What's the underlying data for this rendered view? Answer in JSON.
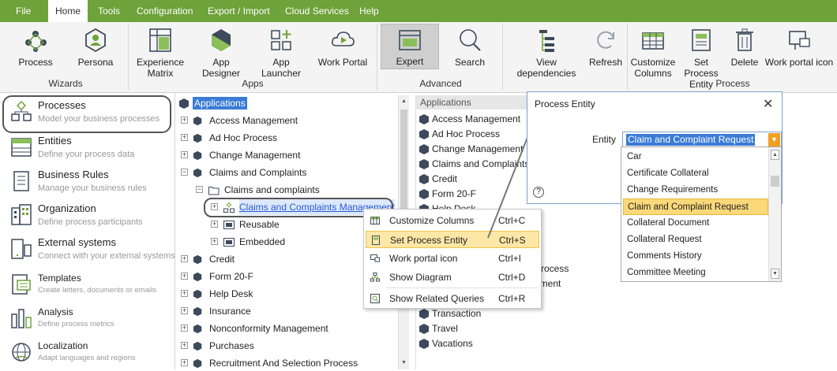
{
  "menubar": {
    "items": [
      "File",
      "Home",
      "Tools",
      "Configuration",
      "Export / Import",
      "Cloud Services",
      "Help"
    ],
    "active": "Home"
  },
  "ribbon": {
    "buttons": [
      {
        "label": "Process"
      },
      {
        "label": "Persona"
      },
      {
        "label": "Experience Matrix"
      },
      {
        "label": "App Designer"
      },
      {
        "label": "App Launcher"
      },
      {
        "label": "Work Portal"
      },
      {
        "label": "Expert"
      },
      {
        "label": "Search"
      },
      {
        "label": "View dependencies"
      },
      {
        "label": "Refresh"
      },
      {
        "label": "Customize Columns"
      },
      {
        "label": "Set Process Entity"
      },
      {
        "label": "Delete"
      },
      {
        "label": "Work portal icon"
      }
    ],
    "groups": [
      "Wizards",
      "Apps",
      "Advanced",
      "Process"
    ]
  },
  "sidebar": {
    "items": [
      {
        "title": "Processes",
        "desc": "Model your business processes"
      },
      {
        "title": "Entities",
        "desc": "Define your process data"
      },
      {
        "title": "Business Rules",
        "desc": "Manage your business rules"
      },
      {
        "title": "Organization",
        "desc": "Define process participants"
      },
      {
        "title": "External systems",
        "desc": "Connect with your external systems"
      },
      {
        "title": "Templates",
        "desc": "Create letters, documents or emails"
      },
      {
        "title": "Analysis",
        "desc": "Define process metrics"
      },
      {
        "title": "Localization",
        "desc": "Adapt languages and regions"
      }
    ]
  },
  "tree": {
    "root": "Applications",
    "items": [
      "Access Management",
      "Ad Hoc Process",
      "Change Management",
      "Claims and Complaints",
      "Claims and complaints",
      "Claims and Complaints Management",
      "Reusable",
      "Embedded",
      "Credit",
      "Form 20-F",
      "Help Desk",
      "Insurance",
      "Nonconformity Management",
      "Purchases",
      "Recruitment And Selection Process"
    ]
  },
  "mid": {
    "header": "Applications",
    "items": [
      "Access Management",
      "Ad Hoc Process",
      "Change Management",
      "Claims and Complaints",
      "Credit",
      "Form 20-F",
      "Help Desk",
      "t",
      "Process",
      "ement",
      "Transaction",
      "Travel",
      "Vacations"
    ]
  },
  "context_menu": {
    "items": [
      {
        "label": "Customize Columns",
        "shortcut": "Ctrl+C"
      },
      {
        "label": "Set Process Entity",
        "shortcut": "Ctrl+S"
      },
      {
        "label": "Work portal icon",
        "shortcut": "Ctrl+I"
      },
      {
        "label": "Show Diagram",
        "shortcut": "Ctrl+D"
      },
      {
        "label": "Show Related Queries",
        "shortcut": "Ctrl+R"
      }
    ],
    "highlighted": "Set Process Entity"
  },
  "dialog": {
    "title": "Process Entity",
    "entity_label": "Entity",
    "entity_value": "Claim and Complaint Request",
    "options": [
      "Car",
      "Certificate Collateral",
      "Change Requirements",
      "Claim and Complaint Request",
      "Collateral Document",
      "Collateral Request",
      "Comments History",
      "Committee Meeting"
    ],
    "highlighted_option": "Claim and Complaint Request",
    "help_icon": "?",
    "close_icon": "close-icon"
  },
  "colors": {
    "accent": "#6ea23a",
    "highlight": "#fde7a6",
    "selection": "#3a7bd5",
    "dropdown": "#f0a020"
  }
}
